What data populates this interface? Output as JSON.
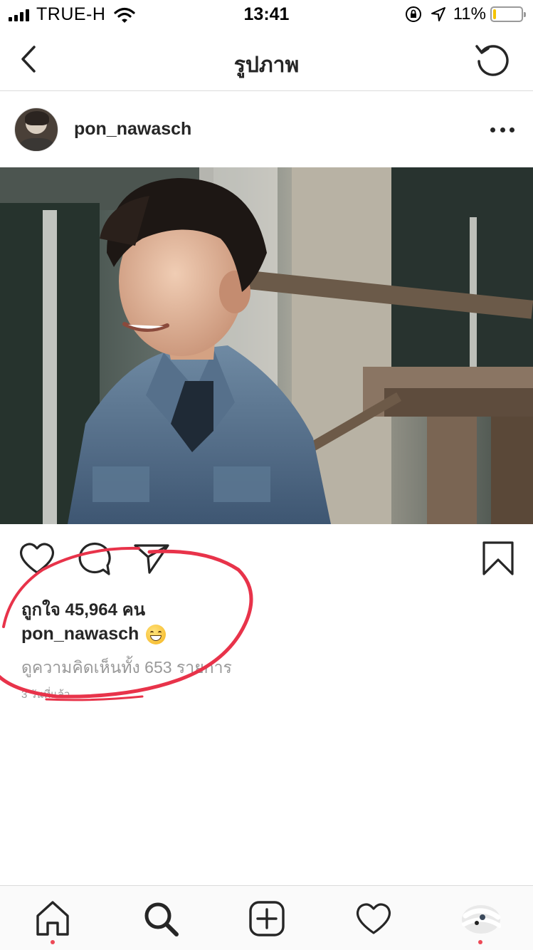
{
  "status_bar": {
    "carrier": "TRUE-H",
    "time": "13:41",
    "battery_percent": "11%",
    "battery_level": 0.11,
    "icons": [
      "signal-icon",
      "wifi-icon",
      "orientation-lock-icon",
      "location-arrow-icon",
      "battery-icon"
    ]
  },
  "header": {
    "title": "รูปภาพ",
    "back_icon": "chevron-left-icon",
    "refresh_icon": "refresh-icon"
  },
  "post": {
    "username": "pon_nawasch",
    "more_icon": "ellipsis-icon",
    "likes_text": "ถูกใจ 45,964 คน",
    "caption_user": "pon_nawasch",
    "caption_emoji": "grinning-face",
    "comments_text": "ดูความคิดเห็นทั้ง 653 รายการ",
    "time_text": "3 วันที่แล้ว",
    "action_icons": [
      "heart-icon",
      "comment-icon",
      "share-icon",
      "bookmark-icon"
    ]
  },
  "annotation_color": "#e8334a",
  "tab_bar": {
    "items": [
      "home-icon",
      "search-icon",
      "add-post-icon",
      "activity-heart-icon",
      "profile-avatar"
    ],
    "notification_color": "#ed4956"
  }
}
